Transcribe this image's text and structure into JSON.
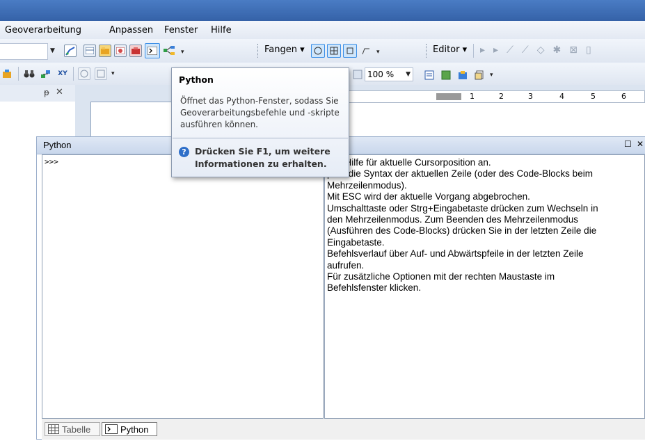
{
  "menu": {
    "items": [
      "Geoverarbeitung",
      "Anpassen",
      "Fenster",
      "Hilfe"
    ]
  },
  "toolbar": {
    "snapping_label": "Fangen",
    "editor_label": "Editor",
    "zoom_value": "100 %",
    "ruler_ticks": [
      "1",
      "2",
      "3",
      "4",
      "5",
      "6"
    ]
  },
  "tooltip": {
    "title": "Python",
    "description": "Öffnet das Python-Fenster, sodass Sie Geoverarbeitungsbefehle und -skripte ausführen können.",
    "help_line1": "Drücken Sie F1, um weitere",
    "help_line2": "Informationen zu erhalten."
  },
  "python_window": {
    "title": "Python",
    "prompt": ">>>",
    "help_lines": [
      "eigt Hilfe für aktuelle Cursorposition an.",
      "prüft die Syntax der aktuellen Zeile (oder des Code-Blocks beim",
      "Mehrzeilenmodus).",
      "Mit ESC wird der aktuelle Vorgang abgebrochen.",
      "Umschalttaste oder Strg+Eingabetaste drücken zum Wechseln in",
      "den Mehrzeilenmodus. Zum Beenden des Mehrzeilenmodus",
      "(Ausführen des Code-Blocks) drücken Sie in der letzten Zeile die",
      "Eingabetaste.",
      "Befehlsverlauf über Auf- und Abwärtspfeile in der letzten Zeile",
      "aufrufen.",
      "Für zusätzliche Optionen mit der rechten Maustaste im",
      "Befehlsfenster klicken."
    ]
  },
  "bottom_tabs": {
    "table_label": "Tabelle",
    "python_label": "Python"
  },
  "colors": {
    "title_bar": "#3f6fb8",
    "toolbar_bg": "#e6ecf5",
    "highlight": "#3a8ee6",
    "help_icon": "#2f6fc9"
  }
}
